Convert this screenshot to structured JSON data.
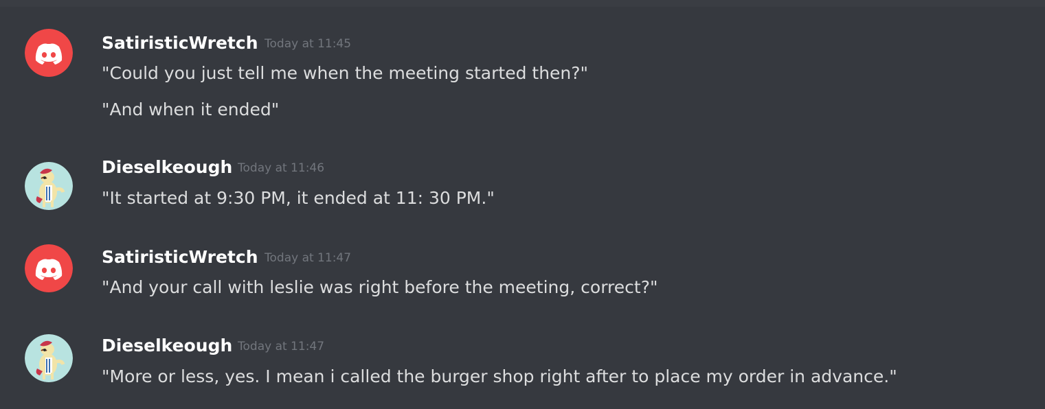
{
  "messages": [
    {
      "author": "SatiristicWretch",
      "avatar": "discord-logo-icon",
      "timestamp": "Today at 11:45",
      "lines": [
        "\"Could you just tell me when the meeting started then?\"",
        "\"And when it ended\""
      ]
    },
    {
      "author": "Dieselkeough",
      "avatar": "pony-avatar-icon",
      "timestamp": "Today at 11:46",
      "lines": [
        "\"It started at 9:30 PM, it ended at 11: 30 PM.\""
      ]
    },
    {
      "author": "SatiristicWretch",
      "avatar": "discord-logo-icon",
      "timestamp": "Today at 11:47",
      "lines": [
        "\"And your call with leslie was right before the meeting, correct?\""
      ]
    },
    {
      "author": "Dieselkeough",
      "avatar": "pony-avatar-icon",
      "timestamp": "Today at 11:47",
      "lines": [
        "\"More or less, yes. I mean i called the burger shop right after to place my order in advance.\""
      ]
    }
  ],
  "colors": {
    "background": "#36393f",
    "username": "#ffffff",
    "timestamp": "#72767d",
    "text": "#dcddde",
    "discord_red": "#f04747"
  }
}
